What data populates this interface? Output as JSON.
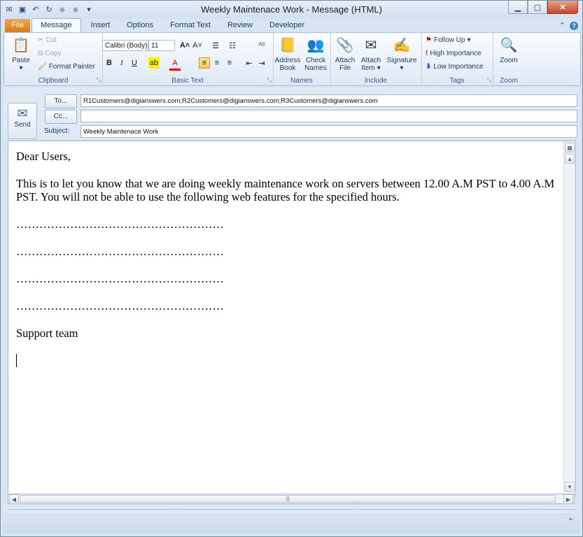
{
  "window": {
    "title": "Weekly Maintenace Work - Message (HTML)"
  },
  "tabs": [
    "File",
    "Message",
    "Insert",
    "Options",
    "Format Text",
    "Review",
    "Developer"
  ],
  "ribbon": {
    "clipboard": {
      "label": "Clipboard",
      "paste": "Paste",
      "cut": "Cut",
      "copy": "Copy",
      "format_painter": "Format Painter"
    },
    "basic_text": {
      "label": "Basic Text",
      "font": "Calibri (Body)",
      "size": "11",
      "bold": "B",
      "italic": "I",
      "underline": "U"
    },
    "names": {
      "label": "Names",
      "address_book": [
        "Address",
        "Book"
      ],
      "check_names": [
        "Check",
        "Names"
      ]
    },
    "include": {
      "label": "Include",
      "attach_file": [
        "Attach",
        "File"
      ],
      "attach_item": [
        "Attach",
        "Item"
      ],
      "signature": "Signature"
    },
    "tags": {
      "label": "Tags",
      "follow_up": "Follow Up",
      "high_importance": "High Importance",
      "low_importance": "Low Importance"
    },
    "zoom": {
      "label": "Zoom",
      "zoom": "Zoom"
    }
  },
  "compose": {
    "send": "Send",
    "to_button": "To...",
    "to_value": "R1Customers@digianswers.com;R2Customers@digianswers.com;R3Customers@digianswers.com",
    "cc_button": "Cc...",
    "cc_value": "",
    "subject_label": "Subject:",
    "subject_value": "Weekly Maintenace Work"
  },
  "body": {
    "greeting": "Dear Users,",
    "paragraph": "This is to let you know that we are doing weekly maintenance work on servers between 12.00 A.M PST to 4.00 A.M PST. You will not be able to use the following web features for the specified hours.",
    "placeholders": [
      "………………………………………………",
      "………………………………………………",
      "………………………………………………",
      "………………………………………………"
    ],
    "signoff": "Support team"
  },
  "colors": {
    "file_tab": "#e07a12",
    "ribbon_bg": "#dde8f5",
    "accent": "#1e395b"
  }
}
